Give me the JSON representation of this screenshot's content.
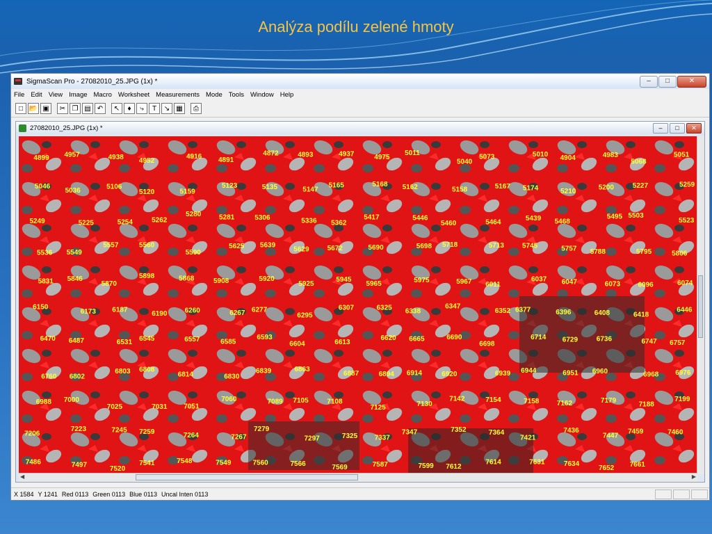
{
  "slide": {
    "title": "Analýza podílu zelené hmoty"
  },
  "app": {
    "title": "SigmaScan Pro - 27082010_25.JPG (1x) *",
    "menu": [
      "File",
      "Edit",
      "View",
      "Image",
      "Macro",
      "Worksheet",
      "Measurements",
      "Mode",
      "Tools",
      "Window",
      "Help"
    ],
    "toolbar_icons": [
      "new-icon",
      "open-icon",
      "save-icon",
      "cut-icon",
      "copy-icon",
      "paste-icon",
      "undo-icon",
      "pointer-icon",
      "fill-icon",
      "trace-icon",
      "text-icon",
      "measure-icon",
      "grid-icon",
      "print-icon"
    ]
  },
  "document": {
    "title": "27082010_25.JPG (1x) *"
  },
  "status": {
    "x": "X 1584",
    "y": "Y 1241",
    "red": "Red 0113",
    "green": "Green 0113",
    "blue": "Blue 0113",
    "inten": "Uncal Inten 0113"
  },
  "labels": [
    "4899",
    "4957",
    "4938",
    "4952",
    "4916",
    "4891",
    "4872",
    "4893",
    "4937",
    "4975",
    "5011",
    "5040",
    "5073",
    "5010",
    "4904",
    "4983",
    "5068",
    "5051",
    "5046",
    "5036",
    "5106",
    "5120",
    "5159",
    "5123",
    "5135",
    "5147",
    "5165",
    "5168",
    "5162",
    "5158",
    "5167",
    "5174",
    "5210",
    "5200",
    "5227",
    "5259",
    "5249",
    "5225",
    "5254",
    "5262",
    "5280",
    "5281",
    "5306",
    "5336",
    "5362",
    "5417",
    "5446",
    "5460",
    "5464",
    "5439",
    "5468",
    "5495",
    "5503",
    "5523",
    "5536",
    "5549",
    "5557",
    "5560",
    "5590",
    "5625",
    "5639",
    "5629",
    "5672",
    "5690",
    "5698",
    "5718",
    "5713",
    "5745",
    "5757",
    "5788",
    "5795",
    "5806",
    "5831",
    "5846",
    "5870",
    "5898",
    "5868",
    "5908",
    "5920",
    "5925",
    "5945",
    "5965",
    "5975",
    "5967",
    "6011",
    "6037",
    "6047",
    "6073",
    "6096",
    "6074",
    "6150",
    "6173",
    "6187",
    "6190",
    "6260",
    "6267",
    "6277",
    "6295",
    "6307",
    "6325",
    "6338",
    "6347",
    "6352",
    "6377",
    "6396",
    "6408",
    "6418",
    "6446",
    "6470",
    "6487",
    "6531",
    "6545",
    "6557",
    "6585",
    "6593",
    "6604",
    "6613",
    "6620",
    "6665",
    "6690",
    "6698",
    "6714",
    "6729",
    "6736",
    "6747",
    "6757",
    "6760",
    "6802",
    "6803",
    "6808",
    "6814",
    "6830",
    "6839",
    "6863",
    "6887",
    "6894",
    "6914",
    "6920",
    "6939",
    "6944",
    "6951",
    "6960",
    "6968",
    "6976",
    "6988",
    "7000",
    "7025",
    "7031",
    "7051",
    "7060",
    "7089",
    "7105",
    "7108",
    "7125",
    "7130",
    "7142",
    "7154",
    "7158",
    "7162",
    "7179",
    "7188",
    "7199",
    "7206",
    "7223",
    "7245",
    "7259",
    "7264",
    "7267",
    "7279",
    "7297",
    "7325",
    "7337",
    "7347",
    "7352",
    "7364",
    "7421",
    "7436",
    "7447",
    "7459",
    "7460",
    "7486",
    "7497",
    "7520",
    "7541",
    "7548",
    "7549",
    "7560",
    "7566",
    "7569",
    "7587",
    "7599",
    "7612",
    "7614",
    "7631",
    "7634",
    "7652",
    "7661"
  ]
}
